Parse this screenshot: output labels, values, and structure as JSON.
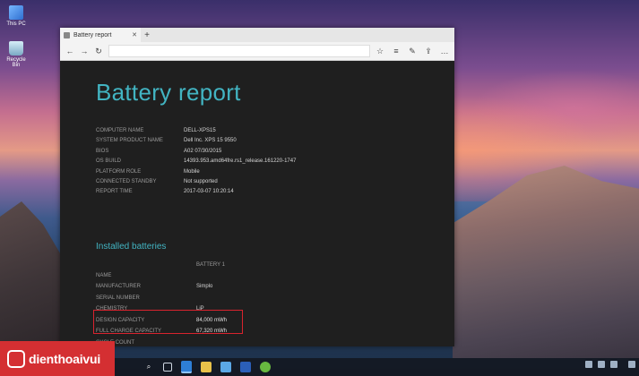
{
  "desktop": {
    "icons": [
      {
        "label": "This PC",
        "icon": "computer-icon"
      },
      {
        "label": "Recycle Bin",
        "icon": "recycle-bin-icon"
      }
    ]
  },
  "browser": {
    "tab_title": "Battery report",
    "address": "",
    "nav_icons": [
      "back-icon",
      "forward-icon",
      "refresh-icon"
    ],
    "tool_icons": [
      "favorite-star-icon",
      "hub-icon",
      "annotate-icon",
      "share-icon",
      "more-icon"
    ]
  },
  "report": {
    "title": "Battery report",
    "info": [
      {
        "label": "COMPUTER NAME",
        "value": "DELL-XPS15"
      },
      {
        "label": "SYSTEM PRODUCT NAME",
        "value": "Dell Inc. XPS 15 9550"
      },
      {
        "label": "BIOS",
        "value": "A02 07/30/2015"
      },
      {
        "label": "OS BUILD",
        "value": "14393.953.amd64fre.rs1_release.161220-1747"
      },
      {
        "label": "PLATFORM ROLE",
        "value": "Mobile"
      },
      {
        "label": "CONNECTED STANDBY",
        "value": "Not supported"
      },
      {
        "label": "REPORT TIME",
        "value": "2017-03-07  10:20:14"
      }
    ],
    "batteries_heading": "Installed batteries",
    "battery_column": "BATTERY 1",
    "batteries": [
      {
        "label": "NAME",
        "value": ""
      },
      {
        "label": "MANUFACTURER",
        "value": "Simplo"
      },
      {
        "label": "SERIAL NUMBER",
        "value": ""
      },
      {
        "label": "CHEMISTRY",
        "value": "LiP"
      },
      {
        "label": "DESIGN CAPACITY",
        "value": "84,000 mWh"
      },
      {
        "label": "FULL CHARGE CAPACITY",
        "value": "67,320 mWh"
      },
      {
        "label": "CYCLE COUNT",
        "value": ""
      }
    ]
  },
  "taskbar": {
    "apps": [
      "search-icon",
      "task-view-icon",
      "edge-icon",
      "file-explorer-icon",
      "store-icon",
      "media-icon",
      "xbox-icon"
    ],
    "search_glyph": "⌕",
    "clock": ""
  },
  "watermark": {
    "text": "dienthoaivui"
  }
}
